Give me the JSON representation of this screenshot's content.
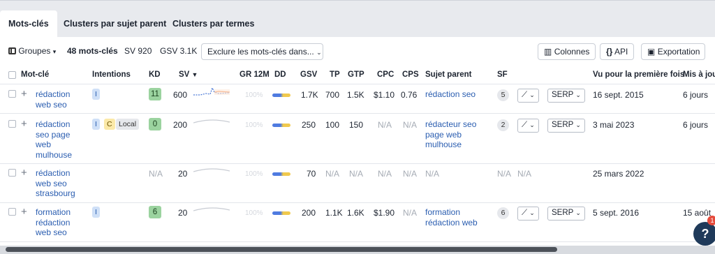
{
  "tabs": [
    {
      "label": "Mots-clés",
      "active": true
    },
    {
      "label": "Clusters par sujet parent",
      "active": false
    },
    {
      "label": "Clusters par termes",
      "active": false
    }
  ],
  "toolbar": {
    "groups_label": "Groupes",
    "count_label": "48 mots-clés",
    "sv_label": "SV 920",
    "gsv_label": "GSV 3.1K",
    "exclude_label": "Exclure les mots-clés dans...",
    "columns_label": "Colonnes",
    "api_label": "API",
    "export_label": "Exportation"
  },
  "headers": {
    "keyword": "Mot-clé",
    "intents": "Intentions",
    "kd": "KD",
    "sv": "SV",
    "gr12m": "GR 12M",
    "dd": "DD",
    "gsv": "GSV",
    "tp": "TP",
    "gtp": "GTP",
    "cpc": "CPC",
    "cps": "CPS",
    "parent": "Sujet parent",
    "sf": "SF",
    "first_seen": "Vu pour la première fois",
    "updated": "Mis à jour"
  },
  "rows": [
    {
      "keyword_lines": [
        "rédaction",
        "web seo"
      ],
      "intents": [
        "I"
      ],
      "kd": "11",
      "sv": "600",
      "gr12m": "100%",
      "gsv": "1.7K",
      "tp": "700",
      "gtp": "1.5K",
      "cpc": "$1.10",
      "cps": "0.76",
      "parent_lines": [
        "rédaction seo"
      ],
      "sf": "5",
      "serp": "SERP",
      "first_seen": "16 sept. 2015",
      "updated": "6 jours"
    },
    {
      "keyword_lines": [
        "rédaction",
        "seo page",
        "web",
        "mulhouse"
      ],
      "intents": [
        "I",
        "C",
        "Local"
      ],
      "kd": "0",
      "sv": "200",
      "gr12m": "100%",
      "gsv": "250",
      "tp": "100",
      "gtp": "150",
      "cpc": "N/A",
      "cps": "N/A",
      "parent_lines": [
        "rédacteur seo",
        "page web",
        "mulhouse"
      ],
      "sf": "2",
      "serp": "SERP",
      "first_seen": "3 mai 2023",
      "updated": "6 jours"
    },
    {
      "keyword_lines": [
        "rédaction",
        "web seo",
        "strasbourg"
      ],
      "intents": [],
      "kd": "N/A",
      "sv": "20",
      "gr12m": "100%",
      "gsv": "70",
      "tp": "N/A",
      "gtp": "N/A",
      "cpc": "N/A",
      "cps": "N/A",
      "parent_lines": [
        "N/A"
      ],
      "sf": "N/A",
      "sf2": "N/A",
      "first_seen": "25 mars 2022",
      "updated": ""
    },
    {
      "keyword_lines": [
        "formation",
        "rédaction",
        "web seo"
      ],
      "intents": [
        "I"
      ],
      "kd": "6",
      "sv": "20",
      "gr12m": "100%",
      "gsv": "200",
      "tp": "1.1K",
      "gtp": "1.6K",
      "cpc": "$1.90",
      "cps": "N/A",
      "parent_lines": [
        "formation",
        "rédaction web"
      ],
      "sf": "6",
      "serp": "SERP",
      "first_seen": "5 sept. 2016",
      "updated": "15 août"
    }
  ],
  "help": {
    "label": "?",
    "badge": "1"
  },
  "colors": {
    "link": "#2a5db0",
    "kd_green": "#9bd39f",
    "intent_blue": "#cfe0f7",
    "intent_yellow": "#fbe9a8"
  },
  "icons": [
    "groups-icon",
    "columns-icon",
    "api-icon",
    "export-icon",
    "sort-down-icon",
    "trend-icon",
    "chevron-down-icon",
    "plus-icon"
  ]
}
